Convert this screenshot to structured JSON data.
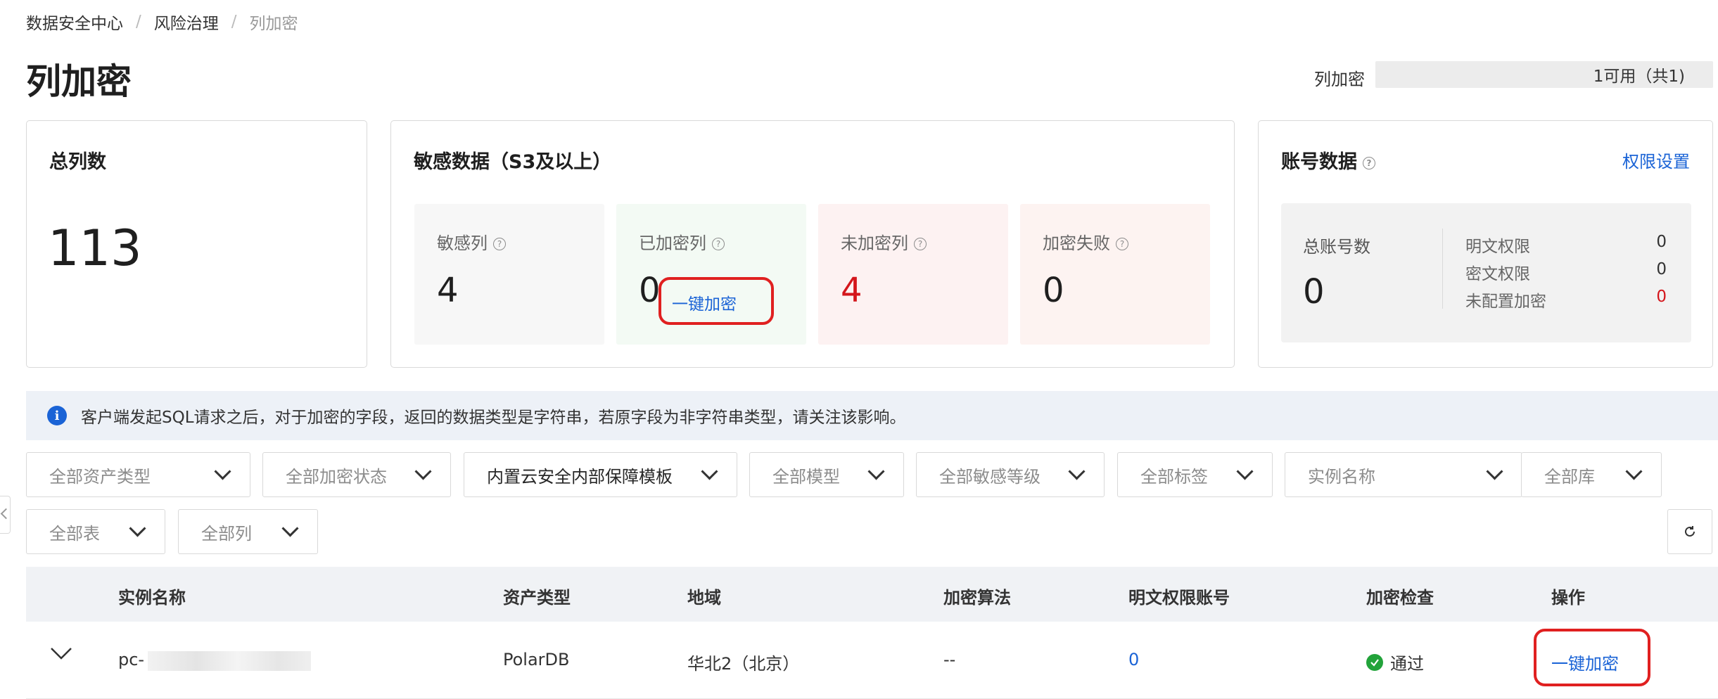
{
  "breadcrumb": [
    "数据安全中心",
    "风险治理",
    "列加密"
  ],
  "page_title": "列加密",
  "header_select": {
    "label": "列加密",
    "value": "1可用（共1)"
  },
  "total_card": {
    "title": "总列数",
    "value": "113"
  },
  "sensitive_card": {
    "title": "敏感数据（S3及以上）",
    "items": [
      {
        "label": "敏感列",
        "value": "4"
      },
      {
        "label": "已加密列",
        "value": "0",
        "action": "一键加密"
      },
      {
        "label": "未加密列",
        "value": "4"
      },
      {
        "label": "加密失败",
        "value": "0"
      }
    ]
  },
  "account_card": {
    "title": "账号数据",
    "link": "权限设置",
    "total_label": "总账号数",
    "total_value": "0",
    "perms": [
      {
        "label": "明文权限",
        "value": "0"
      },
      {
        "label": "密文权限",
        "value": "0"
      },
      {
        "label": "未配置加密",
        "value": "0"
      }
    ]
  },
  "notice": "客户端发起SQL请求之后，对于加密的字段，返回的数据类型是字符串，若原字段为非字符串类型，请关注该影响。",
  "filters": [
    "全部资产类型",
    "全部加密状态",
    "内置云安全内部保障模板",
    "全部模型",
    "全部敏感等级",
    "全部标签",
    "实例名称",
    "全部库",
    "全部表",
    "全部列"
  ],
  "table": {
    "headers": [
      "实例名称",
      "资产类型",
      "地域",
      "加密算法",
      "明文权限账号",
      "加密检查",
      "操作"
    ],
    "rows": [
      {
        "instance": "pc-",
        "asset_type": "PolarDB",
        "region": "华北2（北京）",
        "algorithm": "--",
        "plain_accounts": "0",
        "check": "通过",
        "action": "一键加密"
      }
    ]
  },
  "colors": {
    "link": "#1a63d6",
    "danger": "#d4161c",
    "success": "#22a33a",
    "highlight": "#e02020"
  }
}
